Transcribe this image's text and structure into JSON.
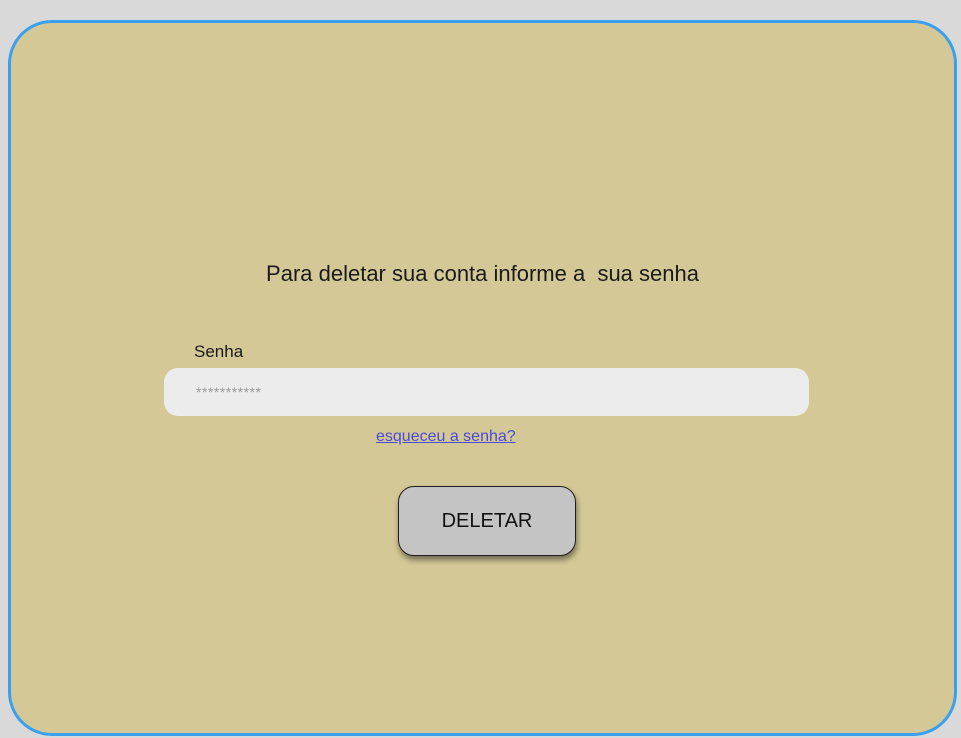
{
  "dialog": {
    "title": "Para deletar sua conta informe a  sua senha",
    "password_label": "Senha",
    "password_placeholder": "***********",
    "forgot_link": "esqueceu a senha?",
    "delete_button": "DELETAR"
  },
  "colors": {
    "card_background": "#d4c896",
    "card_border": "#3aa0ee",
    "input_background": "#ececec",
    "link": "#4b4bd8",
    "button_background": "#c4c4c4"
  }
}
